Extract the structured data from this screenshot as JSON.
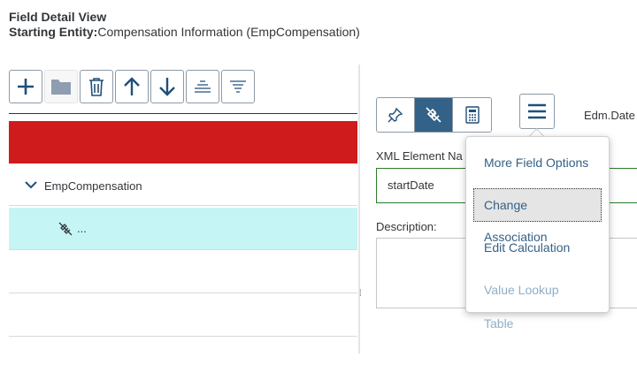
{
  "header": {
    "title": "Field Detail View",
    "entity_label": "Starting Entity:",
    "entity_value": "Compensation Information (EmpCompensation)"
  },
  "toolbar": {
    "buttons": [
      {
        "icon": "plus-icon",
        "enabled": true
      },
      {
        "icon": "folder-icon",
        "enabled": false
      },
      {
        "icon": "trash-icon",
        "enabled": true
      },
      {
        "icon": "arrow-up-icon",
        "enabled": true
      },
      {
        "icon": "arrow-down-icon",
        "enabled": true
      },
      {
        "icon": "align-center-icon",
        "enabled": true
      },
      {
        "icon": "filter-icon",
        "enabled": true
      }
    ]
  },
  "tree": {
    "node_label": "EmpCompensation",
    "child_label": "..."
  },
  "detail": {
    "edm_type": "Edm.Date",
    "xml_label": "XML Element Na",
    "xml_value": "startDate",
    "description_label": "Description:"
  },
  "menu": {
    "items": [
      {
        "label": "More Field Options",
        "state": "normal"
      },
      {
        "label": "Change Association",
        "state": "focused"
      },
      {
        "label": "Edit Calculation",
        "state": "normal"
      },
      {
        "label": "Value Lookup Table",
        "state": "disabled"
      }
    ]
  },
  "colors": {
    "accent": "#346187",
    "error_row": "#cf1b1b",
    "selected_row": "#c5f6f5",
    "valid_border": "#2b7c2b"
  }
}
